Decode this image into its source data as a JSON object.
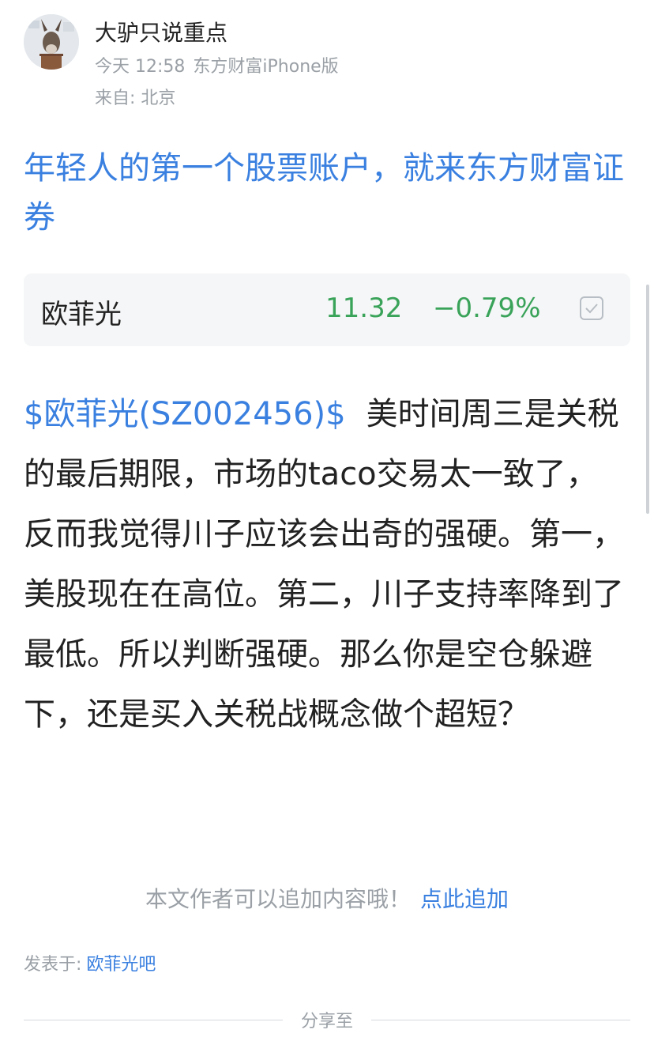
{
  "post": {
    "author": "大驴只说重点",
    "time": "今天 12:58",
    "client": "东方财富iPhone版",
    "location": "来自: 北京"
  },
  "headline": "年轻人的第一个股票账户，就来东方财富证券",
  "quote": {
    "name": "欧菲光",
    "price": "11.32",
    "change": "−0.79%"
  },
  "body": {
    "stock_tag": "$欧菲光(SZ002456)$",
    "text": "美时间周三是关税的最后期限，市场的taco交易太一致了，反而我觉得川子应该会出奇的强硬。第一，美股现在在高位。第二，川子支持率降到了最低。所以判断强硬。那么你是空仓躲避下，还是买入关税战概念做个超短？"
  },
  "append": {
    "prompt": "本文作者可以追加内容哦！",
    "link": "点此追加"
  },
  "published": {
    "label": "发表于:",
    "forum": "欧菲光吧"
  },
  "share": {
    "label": "分享至"
  },
  "colors": {
    "link_blue": "#3a80e0",
    "down_green": "#3aa35a",
    "meta_gray": "#9aa0a6",
    "card_bg": "#f5f6f7"
  }
}
